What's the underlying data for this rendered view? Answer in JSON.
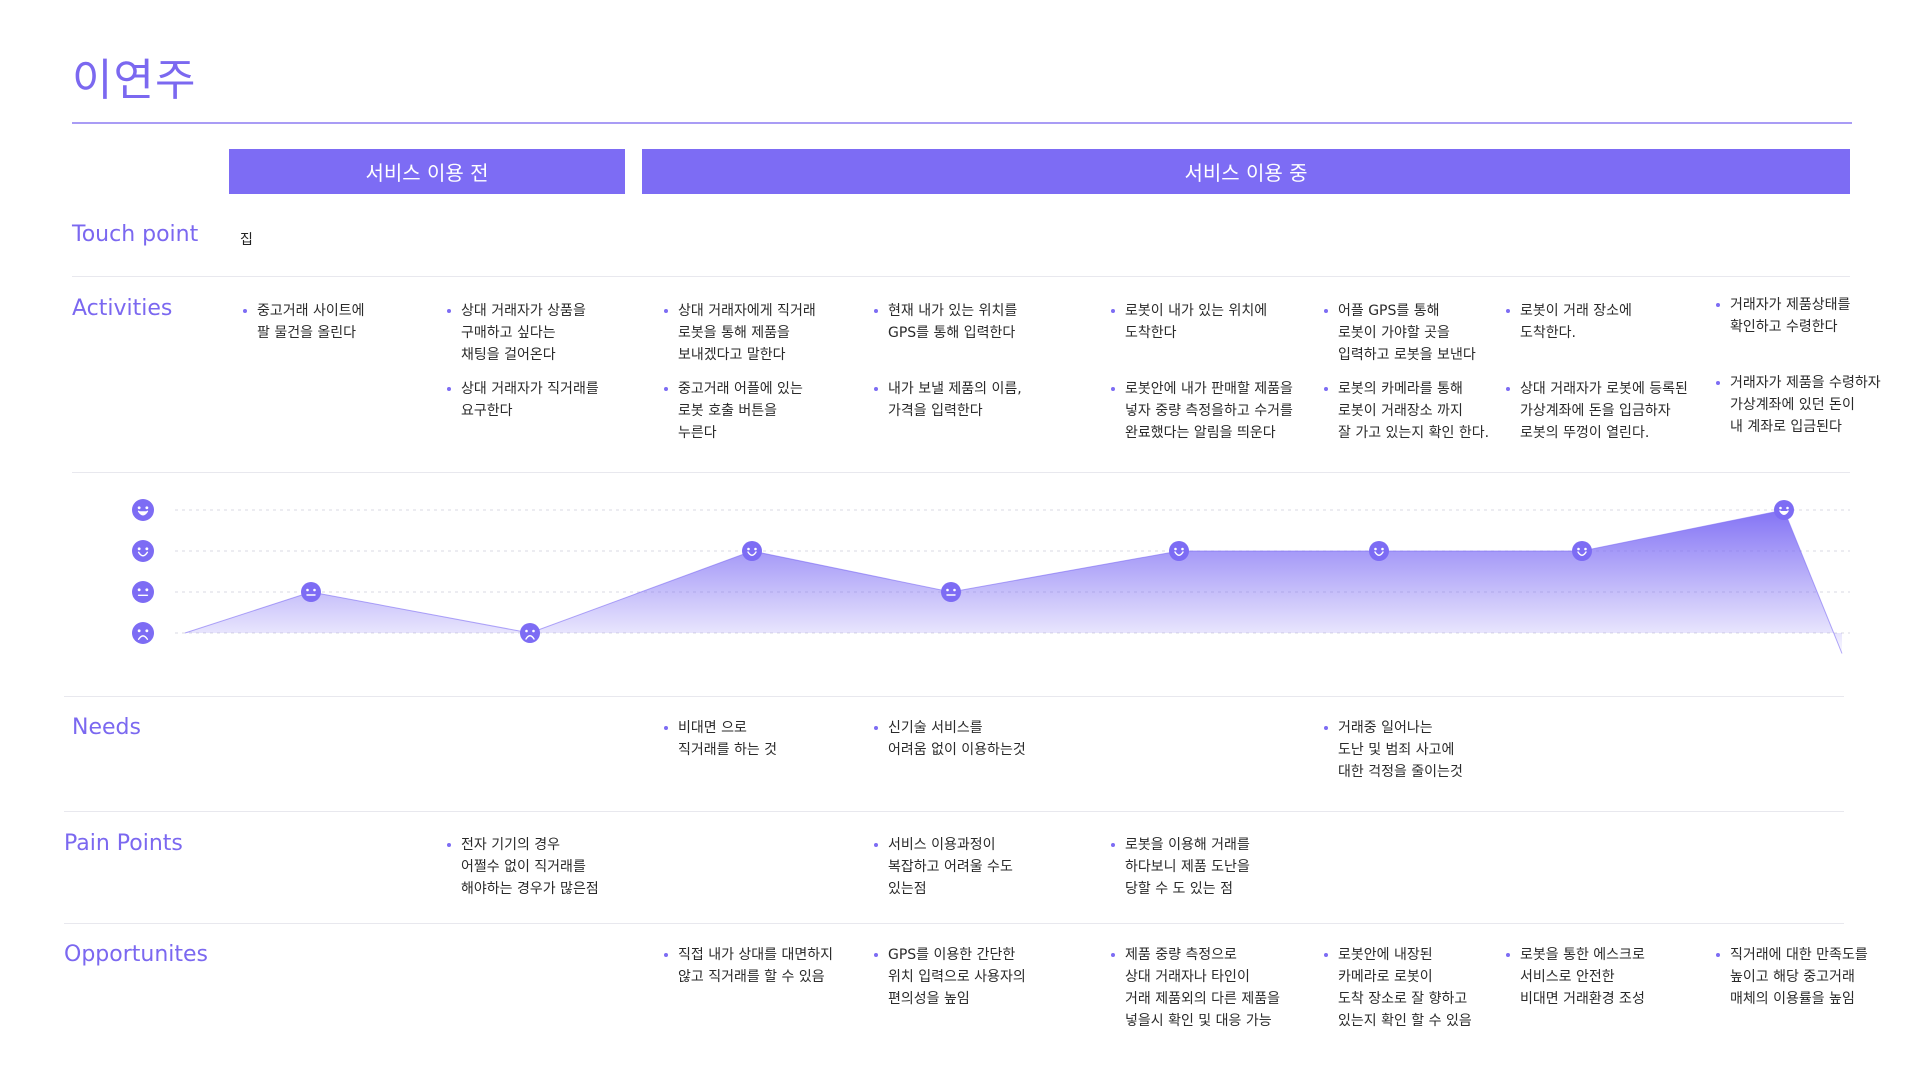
{
  "title": "이연주",
  "phases": [
    "서비스 이용 전",
    "서비스 이용 중"
  ],
  "rows": {
    "touch_point": "Touch point",
    "activities": "Activities",
    "needs": "Needs",
    "pain_points": "Pain Points",
    "opportunities": "Opportunites"
  },
  "touch_point_value": "집",
  "activities": [
    [
      [
        "중고거래 사이트에",
        "팔 물건을 올린다"
      ]
    ],
    [
      [
        "상대 거래자가 상품을",
        "구매하고 싶다는",
        "채팅을 걸어온다"
      ],
      [
        "상대 거래자가 직거래를",
        "요구한다"
      ]
    ],
    [
      [
        "상대 거래자에게 직거래",
        "로봇을 통해 제품을",
        "보내겠다고 말한다"
      ],
      [
        "중고거래 어플에 있는",
        "로봇 호출 버튼을",
        "누른다"
      ]
    ],
    [
      [
        "현재 내가 있는 위치를",
        "GPS를 통해 입력한다"
      ],
      [
        "내가 보낼 제품의 이름,",
        "가격을 입력한다"
      ]
    ],
    [
      [
        "로봇이 내가 있는 위치에",
        "도착한다"
      ],
      [
        "로봇안에 내가 판매할 제품을",
        "넣자 중량 측정을하고 수거를",
        "완료했다는 알림을 띄운다"
      ]
    ],
    [
      [
        "어플 GPS를 통해",
        "로봇이 가야할 곳을",
        "입력하고 로봇을 보낸다"
      ],
      [
        "로봇의 카메라를 통해",
        "로봇이 거래장소 까지",
        "잘 가고 있는지 확인 한다."
      ]
    ],
    [
      [
        "로봇이 거래 장소에",
        "도착한다."
      ],
      [
        "상대 거래자가 로봇에 등록된",
        "가상계좌에 돈을 입금하자",
        "로봇의 뚜껑이 열린다."
      ]
    ],
    [
      [
        "거래자가 제품상태를",
        "확인하고 수령한다"
      ],
      [
        "거래자가 제품을 수령하자",
        "가상계좌에 있던 돈이",
        "내 계좌로 입금된다"
      ]
    ]
  ],
  "emotion_chart": {
    "chart_data": {
      "type": "area",
      "levels": [
        "very-happy",
        "happy",
        "neutral",
        "sad"
      ],
      "values": [
        1,
        2,
        1,
        3,
        2,
        3,
        3,
        3,
        4,
        0.5
      ],
      "ylim": [
        0,
        4
      ],
      "fill_color": "#7d6cf4"
    }
  },
  "needs": [
    {
      "col": 2,
      "lines": [
        "비대면 으로",
        "직거래를 하는 것"
      ]
    },
    {
      "col": 3,
      "lines": [
        "신기술 서비스를",
        "어려움 없이 이용하는것"
      ]
    },
    {
      "col": 5,
      "lines": [
        "거래중 일어나는",
        "도난 및 범죄 사고에",
        "대한 걱정을 줄이는것"
      ]
    }
  ],
  "pain_points": [
    {
      "col": 1,
      "lines": [
        "전자 기기의 경우",
        "어쩔수 없이 직거래를",
        "해야하는 경우가 많은점"
      ]
    },
    {
      "col": 3,
      "lines": [
        "서비스 이용과정이",
        "복잡하고 어려울 수도",
        "있는점"
      ]
    },
    {
      "col": 4,
      "lines": [
        "로봇을 이용해 거래를",
        "하다보니 제품 도난을",
        "당할 수 도 있는 점"
      ]
    }
  ],
  "opportunities": [
    {
      "col": 2,
      "lines": [
        "직접 내가 상대를 대면하지",
        "않고 직거래를 할 수 있음"
      ]
    },
    {
      "col": 3,
      "lines": [
        "GPS를 이용한 간단한",
        "위치 입력으로 사용자의",
        "편의성을 높임"
      ]
    },
    {
      "col": 4,
      "lines": [
        "제품 중량 측정으로",
        "상대 거래자나 타인이",
        "거래 제품외의 다른 제품을",
        "넣을시 확인 및 대응 가능"
      ]
    },
    {
      "col": 5,
      "lines": [
        "로봇안에 내장된",
        "카메라로 로봇이",
        "도착 장소로 잘 향하고",
        "있는지 확인 할 수 있음"
      ]
    },
    {
      "col": 6,
      "lines": [
        "로봇을 통한 에스크로",
        "서비스로 안전한",
        "비대면 거래환경 조성"
      ]
    },
    {
      "col": 7,
      "lines": [
        "직거래에 대한 만족도를",
        "높이고 해당 중고거래",
        "매체의 이용률을 높임"
      ]
    }
  ]
}
